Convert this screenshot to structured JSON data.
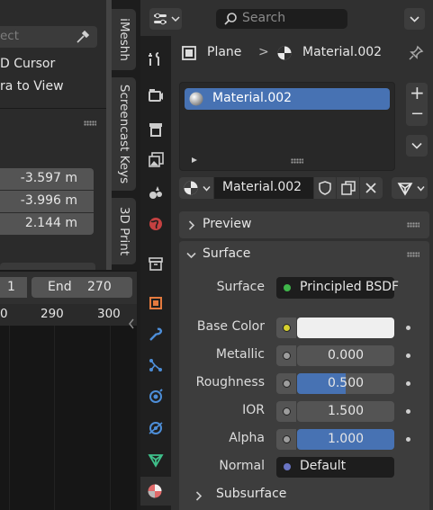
{
  "viewport": {
    "search_placeholder": "ect",
    "menu_items": [
      "D Cursor",
      "ra to View"
    ],
    "transform_values": [
      "-3.597 m",
      "-3.996 m",
      "2.144 m"
    ]
  },
  "sidebar_tabs": [
    "iMeshh",
    "Screencast Keys",
    "3D Print"
  ],
  "timeline": {
    "start_value": "1",
    "end_label": "End",
    "end_value": "270",
    "ticks": [
      "0",
      "290",
      "300"
    ]
  },
  "header": {
    "search_placeholder": "Search"
  },
  "breadcrumb": {
    "object": "Plane",
    "separator": ">",
    "material": "Material.002"
  },
  "material_slots": {
    "items": [
      {
        "label": "Material.002"
      }
    ],
    "add_label": "+",
    "remove_label": "−"
  },
  "material_selector": {
    "name": "Material.002"
  },
  "panels": {
    "preview": "Preview",
    "surface": "Surface",
    "subsurface": "Subsurface"
  },
  "surface": {
    "surface_label": "Surface",
    "surface_value": "Principled BSDF",
    "surface_socket_color": "#3fb64a",
    "rows": [
      {
        "label": "Base Color",
        "value": "",
        "socket_color": "#d6d02e",
        "swatch": "#efefef"
      },
      {
        "label": "Metallic",
        "value": "0.000",
        "fraction": 0.0
      },
      {
        "label": "Roughness",
        "value": "0.500",
        "fraction": 0.5
      },
      {
        "label": "IOR",
        "value": "1.500"
      },
      {
        "label": "Alpha",
        "value": "1.000",
        "fraction": 1.0
      },
      {
        "label": "Normal",
        "value": "Default",
        "socket_color": "#6a75c4"
      }
    ]
  },
  "colors": {
    "accent": "#4772b3",
    "slot_selected": "#4772b3"
  }
}
